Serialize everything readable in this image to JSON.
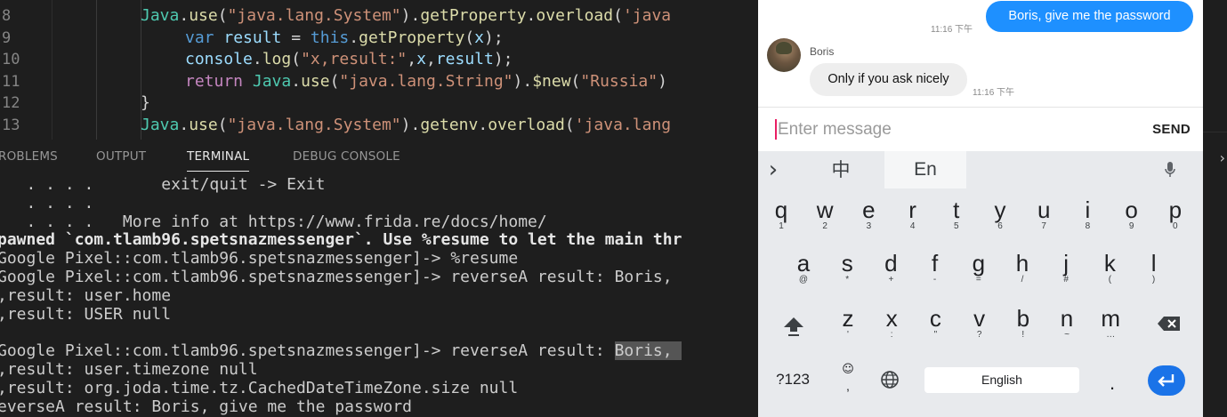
{
  "editor": {
    "line_numbers": [
      "8",
      "9",
      "10",
      "11",
      "12",
      "13"
    ],
    "lines": [
      [
        {
          "t": "Java",
          "c": "t-ty"
        },
        {
          "t": ".",
          "c": "t-pun"
        },
        {
          "t": "use",
          "c": "t-fn"
        },
        {
          "t": "(",
          "c": "t-pun"
        },
        {
          "t": "\"java.lang.System\"",
          "c": "t-str"
        },
        {
          "t": ").",
          "c": "t-pun"
        },
        {
          "t": "getProperty",
          "c": "t-fn"
        },
        {
          "t": ".",
          "c": "t-pun"
        },
        {
          "t": "overload",
          "c": "t-fn"
        },
        {
          "t": "(",
          "c": "t-pun"
        },
        {
          "t": "'java",
          "c": "t-str"
        }
      ],
      [
        {
          "t": "var ",
          "c": "t-kw"
        },
        {
          "t": "result",
          "c": "t-var"
        },
        {
          "t": " = ",
          "c": "t-pun"
        },
        {
          "t": "this",
          "c": "t-kw"
        },
        {
          "t": ".",
          "c": "t-pun"
        },
        {
          "t": "getProperty",
          "c": "t-fn"
        },
        {
          "t": "(",
          "c": "t-pun"
        },
        {
          "t": "x",
          "c": "t-var"
        },
        {
          "t": ");",
          "c": "t-pun"
        }
      ],
      [
        {
          "t": "console",
          "c": "t-var"
        },
        {
          "t": ".",
          "c": "t-pun"
        },
        {
          "t": "log",
          "c": "t-fn"
        },
        {
          "t": "(",
          "c": "t-pun"
        },
        {
          "t": "\"x,result:\"",
          "c": "t-str"
        },
        {
          "t": ",",
          "c": "t-pun"
        },
        {
          "t": "x",
          "c": "t-var"
        },
        {
          "t": ",",
          "c": "t-pun"
        },
        {
          "t": "result",
          "c": "t-var"
        },
        {
          "t": ");",
          "c": "t-pun"
        }
      ],
      [
        {
          "t": "return ",
          "c": "t-ctl"
        },
        {
          "t": "Java",
          "c": "t-ty"
        },
        {
          "t": ".",
          "c": "t-pun"
        },
        {
          "t": "use",
          "c": "t-fn"
        },
        {
          "t": "(",
          "c": "t-pun"
        },
        {
          "t": "\"java.lang.String\"",
          "c": "t-str"
        },
        {
          "t": ").",
          "c": "t-pun"
        },
        {
          "t": "$new",
          "c": "t-fn"
        },
        {
          "t": "(",
          "c": "t-pun"
        },
        {
          "t": "\"Russia\"",
          "c": "t-str"
        },
        {
          "t": ")",
          "c": "t-pun"
        }
      ],
      [
        {
          "t": "}",
          "c": "t-pun"
        }
      ],
      [
        {
          "t": "Java",
          "c": "t-ty"
        },
        {
          "t": ".",
          "c": "t-pun"
        },
        {
          "t": "use",
          "c": "t-fn"
        },
        {
          "t": "(",
          "c": "t-pun"
        },
        {
          "t": "\"java.lang.System\"",
          "c": "t-str"
        },
        {
          "t": ").",
          "c": "t-pun"
        },
        {
          "t": "getenv",
          "c": "t-fn"
        },
        {
          "t": ".",
          "c": "t-pun"
        },
        {
          "t": "overload",
          "c": "t-fn"
        },
        {
          "t": "(",
          "c": "t-pun"
        },
        {
          "t": "'java.lang",
          "c": "t-str"
        }
      ]
    ]
  },
  "panel": {
    "tabs": [
      "ROBLEMS",
      "OUTPUT",
      "TERMINAL",
      "DEBUG CONSOLE"
    ],
    "active_tab": "TERMINAL"
  },
  "terminal": {
    "lines": [
      {
        "text": "   . . . .       exit/quit -> Exit",
        "bold": false
      },
      {
        "text": "   . . . .",
        "bold": false
      },
      {
        "text": "   . . . .   More info at https://www.frida.re/docs/home/",
        "bold": false
      },
      {
        "text": "pawned `com.tlamb96.spetsnazmessenger`. Use %resume to let the main thr",
        "bold": true
      },
      {
        "text": "Google Pixel::com.tlamb96.spetsnazmessenger]-> %resume",
        "bold": false
      },
      {
        "text": "Google Pixel::com.tlamb96.spetsnazmessenger]-> reverseA result: Boris,",
        "bold": false
      },
      {
        "text": ",result: user.home",
        "bold": false
      },
      {
        "text": ",result: USER null",
        "bold": false
      },
      {
        "text": "",
        "bold": false
      },
      {
        "text": "Google Pixel::com.tlamb96.spetsnazmessenger]-> reverseA result: ",
        "bold": false,
        "highlight": "Boris, "
      },
      {
        "text": ",result: user.timezone null",
        "bold": false
      },
      {
        "text": ",result: org.joda.time.tz.CachedDateTimeZone.size null",
        "bold": false
      },
      {
        "text": "everseA result: Boris, give me the password",
        "bold": false
      }
    ]
  },
  "chat": {
    "sent_message": "Boris, give me the password",
    "sent_time": "11:16 下午",
    "sender_name": "Boris",
    "received_message": "Only if you ask nicely",
    "received_time": "11:16 下午"
  },
  "composer": {
    "placeholder": "Enter message",
    "send_label": "SEND"
  },
  "keyboard": {
    "toolbar": {
      "expand_glyph": "›",
      "chinese": "中",
      "english": "En",
      "mic_glyph": "🎤"
    },
    "row1": [
      [
        "q",
        "1"
      ],
      [
        "w",
        "2"
      ],
      [
        "e",
        "3"
      ],
      [
        "r",
        "4"
      ],
      [
        "t",
        "5"
      ],
      [
        "y",
        "6"
      ],
      [
        "u",
        "7"
      ],
      [
        "i",
        "8"
      ],
      [
        "o",
        "9"
      ],
      [
        "p",
        "0"
      ]
    ],
    "row2": [
      [
        "a",
        "@"
      ],
      [
        "s",
        "*"
      ],
      [
        "d",
        "+"
      ],
      [
        "f",
        "-"
      ],
      [
        "g",
        "="
      ],
      [
        "h",
        "/"
      ],
      [
        "j",
        "#"
      ],
      [
        "k",
        "("
      ],
      [
        "l",
        ")"
      ]
    ],
    "row3": [
      [
        "z",
        "'"
      ],
      [
        "x",
        ":"
      ],
      [
        "c",
        "\""
      ],
      [
        "v",
        "?"
      ],
      [
        "b",
        "!"
      ],
      [
        "n",
        "~"
      ],
      [
        "m",
        "…"
      ]
    ],
    "symbols_label": "?123",
    "emoji_glyph": "☺",
    "comma_glyph": ",",
    "globe_glyph": "🌐",
    "space_label": "English",
    "period_glyph": ".",
    "shift_glyph": "⬆",
    "backspace_glyph": "⌫",
    "enter_glyph": "↵"
  },
  "right_strip": {
    "arrow_glyph": "›"
  }
}
